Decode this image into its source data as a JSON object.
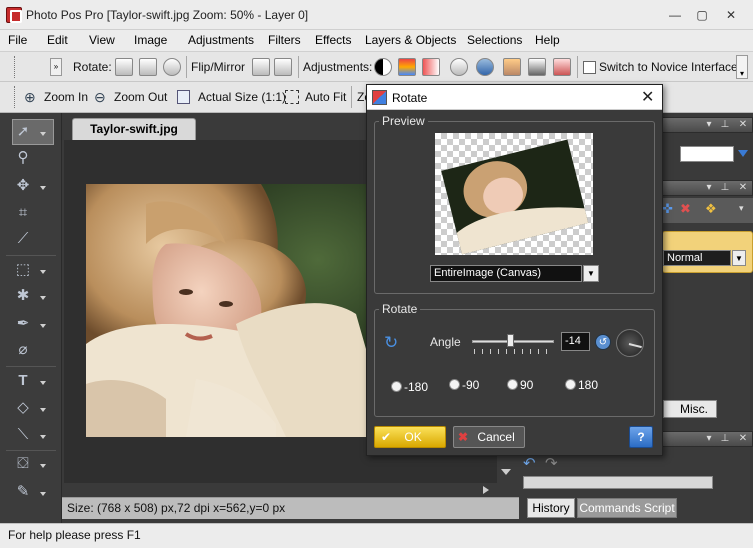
{
  "window": {
    "title": "Photo Pos Pro [Taylor-swift.jpg Zoom: 50% - Layer 0]",
    "min": "—",
    "max": "▢",
    "close": "✕"
  },
  "menu": [
    "File",
    "Edit",
    "View",
    "Image",
    "Adjustments",
    "Filters",
    "Effects",
    "Layers & Objects",
    "Selections",
    "Help"
  ],
  "toolbar1": {
    "rotate_label": "Rotate:",
    "flip_label": "Flip/Mirror",
    "adjust_label": "Adjustments:",
    "novice_label": "Switch to Novice Interface"
  },
  "toolbar2": {
    "zoom_in": "Zoom In",
    "zoom_out": "Zoom Out",
    "actual_size": "Actual Size (1:1)",
    "auto_fit": "Auto Fit",
    "partial": "Zo"
  },
  "document": {
    "tab": "Taylor-swift.jpg",
    "status": "Size: (768 x 508) px,72 dpi   x=562,y=0 px"
  },
  "right_panel": {
    "blend_mode": "Normal",
    "misc_tab": "Misc.",
    "history_tab": "History",
    "commands_tab": "Commands Script"
  },
  "dialog": {
    "title": "Rotate",
    "preview_group": "Preview",
    "preview_select": "EntireImage (Canvas)",
    "rotate_group": "Rotate",
    "angle_label": "Angle",
    "angle_value": "-14",
    "angle_slider_level": -14,
    "presets": [
      "-180",
      "-90",
      "90",
      "180"
    ],
    "ok": "OK",
    "cancel": "Cancel",
    "help": "?"
  },
  "statusbar": "For help please press F1",
  "colors": {
    "accent_ok": "#e8b400",
    "cancel_icon": "#c0392b",
    "help_btn": "#2b6cc4"
  }
}
